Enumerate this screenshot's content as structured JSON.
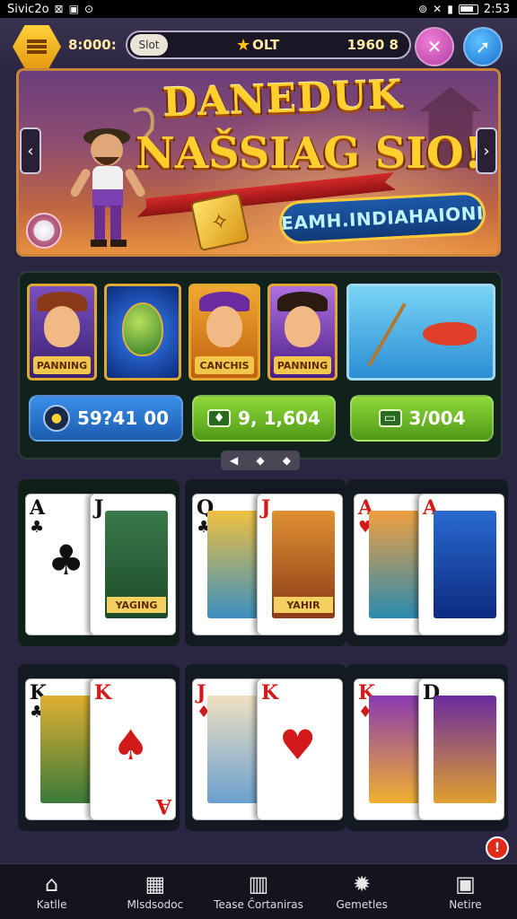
{
  "status_bar": {
    "left_text": "Sivic2o",
    "time": "2:53"
  },
  "top_bar": {
    "coins": "8:000:",
    "xp_label": "Slot",
    "xp_mid": "OLT",
    "xp_right": "1960 8"
  },
  "banner": {
    "title_line1": "DANEDUK",
    "title_line2": "NAŠSIAG SIO!",
    "cta": "EAMH.INDIAHAIONI"
  },
  "game_tiles": [
    {
      "caption": "PANNING",
      "type": "pirate"
    },
    {
      "caption": "",
      "type": "egg"
    },
    {
      "caption": "CANCHIS",
      "type": "jester"
    },
    {
      "caption": "PANNING",
      "type": "cowboy"
    },
    {
      "caption": "",
      "type": "fishing"
    }
  ],
  "stats": [
    {
      "value": "59?41 00",
      "icon": "coin-icon"
    },
    {
      "value": "9, 1,604",
      "icon": "gift-icon"
    },
    {
      "value": "3/004",
      "icon": "ticket-icon"
    }
  ],
  "card_groups": [
    {
      "back": {
        "rank": "A",
        "suit": "♣",
        "color": "black"
      },
      "front": {
        "rank": "J",
        "suit": "♣",
        "color": "black",
        "label": "YAGING"
      }
    },
    {
      "back": {
        "rank": "Q",
        "suit": "♣",
        "color": "black"
      },
      "front": {
        "rank": "J",
        "suit": "♠",
        "color": "red",
        "label": "YAHIR"
      }
    },
    {
      "back": {
        "rank": "A",
        "suit": "♥",
        "color": "red"
      },
      "front": {
        "rank": "A",
        "suit": "♥",
        "color": "red",
        "label": ""
      }
    },
    {
      "back": {
        "rank": "K",
        "suit": "♣",
        "color": "black"
      },
      "front": {
        "rank": "K",
        "suit": "♠",
        "color": "red",
        "label": ""
      }
    },
    {
      "back": {
        "rank": "J",
        "suit": "♦",
        "color": "red"
      },
      "front": {
        "rank": "K",
        "suit": "♠",
        "color": "red",
        "label": ""
      }
    },
    {
      "back": {
        "rank": "K",
        "suit": "♦",
        "color": "red"
      },
      "front": {
        "rank": "D",
        "suit": "♠",
        "color": "black",
        "label": ""
      }
    }
  ],
  "notification_badge": "!",
  "bottom_nav": [
    {
      "label": "Katlle",
      "icon": "home-icon"
    },
    {
      "label": "Mlsdsodoc",
      "icon": "grid-icon"
    },
    {
      "label": "Tease Ĉortaniras",
      "icon": "map-icon"
    },
    {
      "label": "Gemetles",
      "icon": "gear-icon"
    },
    {
      "label": "Netire",
      "icon": "frame-icon"
    }
  ]
}
